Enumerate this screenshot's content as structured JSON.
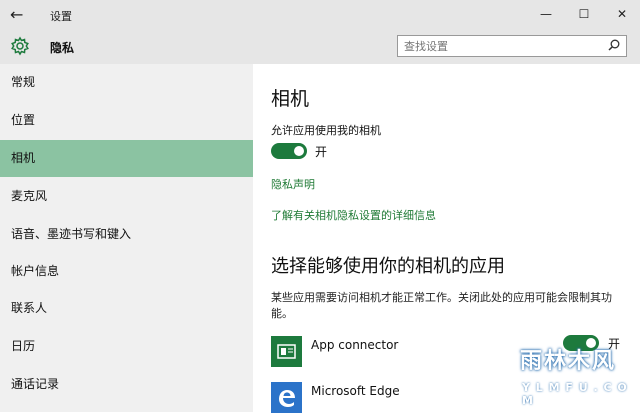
{
  "window": {
    "back_glyph": "←",
    "title": "设置",
    "min_glyph": "—",
    "max_glyph": "☐",
    "close_glyph": "✕"
  },
  "header": {
    "title": "隐私",
    "search_placeholder": "查找设置"
  },
  "sidebar": {
    "items": [
      {
        "label": "常规"
      },
      {
        "label": "位置"
      },
      {
        "label": "相机",
        "active": true
      },
      {
        "label": "麦克风"
      },
      {
        "label": "语音、墨迹书写和键入"
      },
      {
        "label": "帐户信息"
      },
      {
        "label": "联系人"
      },
      {
        "label": "日历"
      },
      {
        "label": "通话记录"
      }
    ]
  },
  "main": {
    "title": "相机",
    "allow_label": "允许应用使用我的相机",
    "toggle_state": "开",
    "privacy_link": "隐私声明",
    "learn_link": "了解有关相机隐私设置的详细信息",
    "apps_title": "选择能够使用你的相机的应用",
    "apps_desc": "某些应用需要访问相机才能正常工作。关闭此处的应用可能会限制其功能。",
    "apps": [
      {
        "name": "App connector",
        "toggle": "开",
        "icon": "app-connector-icon"
      },
      {
        "name": "Microsoft Edge",
        "icon": "edge-icon"
      }
    ]
  },
  "watermark": {
    "line1": "雨林木风",
    "line2": "Y L M F U . C O M"
  },
  "colors": {
    "accent": "#1d7a3d",
    "sidebar_active": "#8bc3a2",
    "chrome": "#e6e6e6",
    "link": "#1f7a35"
  }
}
